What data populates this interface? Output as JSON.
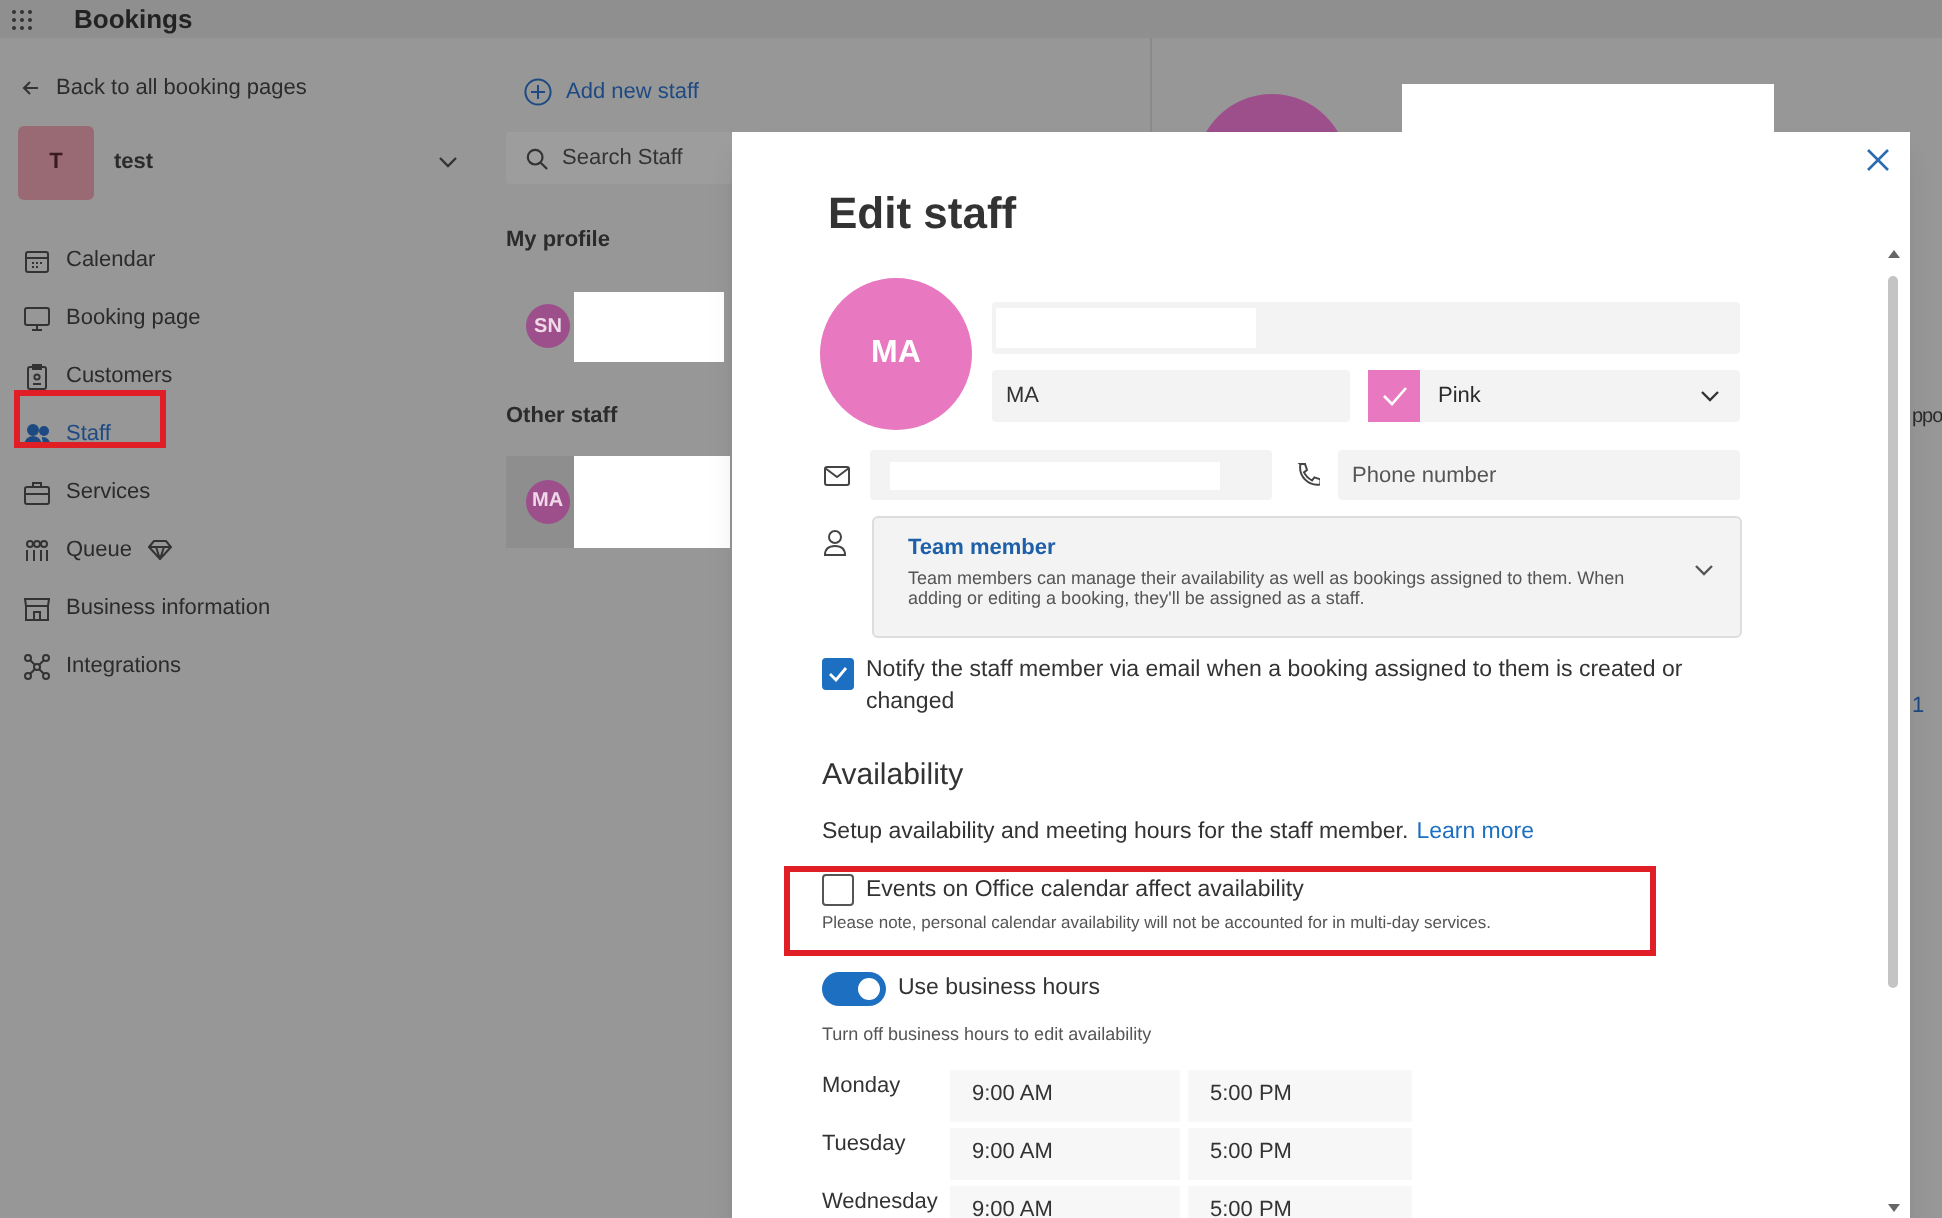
{
  "app": {
    "title": "Bookings"
  },
  "sidebar": {
    "back_link": "Back to all booking pages",
    "business": {
      "initial": "T",
      "name": "test"
    },
    "items": [
      {
        "label": "Calendar",
        "selected": false,
        "premium": false
      },
      {
        "label": "Booking page",
        "selected": false,
        "premium": false
      },
      {
        "label": "Customers",
        "selected": false,
        "premium": false
      },
      {
        "label": "Staff",
        "selected": true,
        "premium": false
      },
      {
        "label": "Services",
        "selected": false,
        "premium": false
      },
      {
        "label": "Queue",
        "selected": false,
        "premium": true
      },
      {
        "label": "Business information",
        "selected": false,
        "premium": false
      },
      {
        "label": "Integrations",
        "selected": false,
        "premium": false
      }
    ]
  },
  "staff_list": {
    "add_button": "Add new staff",
    "search": {
      "placeholder": "Search Staff"
    },
    "sections": [
      {
        "heading": "My profile",
        "members": [
          {
            "initials": "SN",
            "selected": false
          }
        ]
      },
      {
        "heading": "Other staff",
        "members": [
          {
            "initials": "MA",
            "selected": true
          }
        ]
      }
    ]
  },
  "detail_panel": {
    "partial_texts": [
      "ppo",
      "1"
    ]
  },
  "dialog": {
    "title": "Edit staff",
    "avatar_initials": "MA",
    "initials_field": {
      "value": "MA"
    },
    "color_select": {
      "value": "Pink"
    },
    "phone_field": {
      "placeholder": "Phone number"
    },
    "role": {
      "title": "Team member",
      "description": "Team members can manage their availability as well as bookings assigned to them. When adding or editing a booking, they'll be assigned as a staff."
    },
    "notify": {
      "label": "Notify the staff member via email when a booking assigned to them is created or changed",
      "checked": true
    },
    "availability": {
      "heading": "Availability",
      "description": "Setup availability and meeting hours for the staff member.",
      "link": "Learn more",
      "calendar_option": {
        "label": "Events on Office calendar affect availability",
        "note": "Please note, personal calendar availability will not be accounted for in multi-day services.",
        "checked": false
      },
      "business_hours": {
        "label": "Use business hours",
        "on": true,
        "hint": "Turn off business hours to edit availability"
      },
      "days": [
        {
          "day": "Monday",
          "start": "9:00 AM",
          "end": "5:00 PM"
        },
        {
          "day": "Tuesday",
          "start": "9:00 AM",
          "end": "5:00 PM"
        },
        {
          "day": "Wednesday",
          "start": "9:00 AM",
          "end": "5:00 PM"
        }
      ]
    }
  }
}
